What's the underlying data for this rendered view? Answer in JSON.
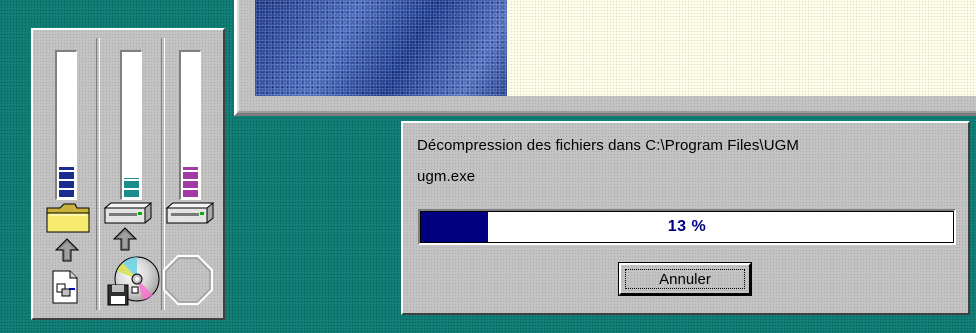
{
  "colors": {
    "desktop": "#0f8077",
    "dialog_face": "#c3c3c3",
    "progress_fill": "#000080",
    "meter_blue": "#1d2d8c",
    "meter_teal": "#1a8c8c",
    "meter_magenta": "#a33aa3"
  },
  "meters": [
    {
      "name": "folder",
      "level": 0.22,
      "color": "#1d2d8c"
    },
    {
      "name": "hard-drive",
      "level": 0.14,
      "color": "#1a8c8c"
    },
    {
      "name": "floppy-cd",
      "level": 0.22,
      "color": "#a33aa3"
    }
  ],
  "icons": [
    "folder-icon",
    "hard-drive-icon",
    "up-arrow-icon",
    "document-icon",
    "cd-icon",
    "floppy-icon",
    "octagon-icon"
  ],
  "progress_dialog": {
    "message_line1": "Décompression des fichiers dans C:\\Program Files\\UGM",
    "message_line2": "ugm.exe",
    "progress_percent": 13,
    "progress_text": "13 %",
    "cancel_label": "Annuler"
  }
}
